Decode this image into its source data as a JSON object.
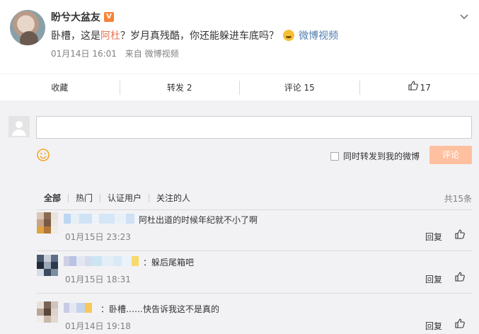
{
  "post": {
    "username": "盼兮大盆友",
    "verified_badge": "V",
    "text_before": "卧槽，这是",
    "text_link": "阿杜",
    "text_after": "？岁月真残酷，你还能躲进车底吗？",
    "video_link": "微博视频",
    "date": "01月14日 16:01",
    "source": "来自 微博视频"
  },
  "actions": {
    "favorite": "收藏",
    "repost": "转发 2",
    "comment": "评论 15",
    "like": "17"
  },
  "composer": {
    "repost_label": "同时转发到我的微博",
    "submit_label": "评论"
  },
  "tabs": {
    "items": [
      "全部",
      "热门",
      "认证用户",
      "关注的人"
    ],
    "total": "共15条"
  },
  "comments": [
    {
      "text": "阿杜出道的时候年纪就不小了啊",
      "date": "01月15日 23:23",
      "reply": "回复"
    },
    {
      "text": "：躲后尾箱吧",
      "date": "01月15日 18:31",
      "reply": "回复"
    },
    {
      "text": "：卧槽……快告诉我这不是真的",
      "date": "01月14日 19:18",
      "reply": "回复"
    }
  ],
  "colors": {
    "accent": "#eb7350",
    "link": "#507daf",
    "submit_disabled": "#ffc09f",
    "verified": "#f7843a"
  }
}
